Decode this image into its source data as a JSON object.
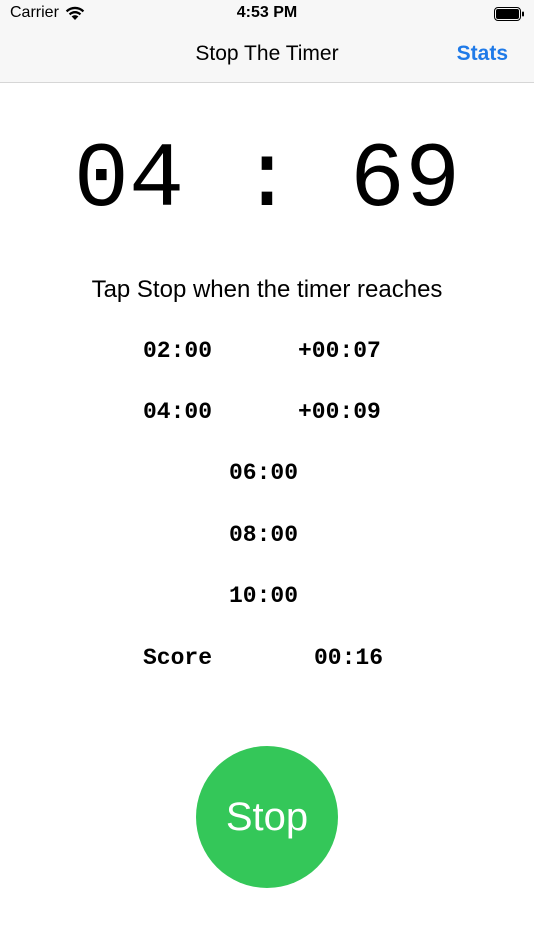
{
  "status_bar": {
    "carrier": "Carrier",
    "time": "4:53 PM",
    "wifi_icon": "wifi-icon",
    "battery_icon": "battery-icon"
  },
  "nav": {
    "title": "Stop The Timer",
    "stats_label": "Stats"
  },
  "timer": {
    "display": "04 : 69"
  },
  "instruction": "Tap Stop when the timer reaches",
  "targets": [
    {
      "target": "02:00",
      "delta": "+00:07"
    },
    {
      "target": "04:00",
      "delta": "+00:09"
    },
    {
      "target": "06:00",
      "delta": ""
    },
    {
      "target": "08:00",
      "delta": ""
    },
    {
      "target": "10:00",
      "delta": ""
    }
  ],
  "score": {
    "label": "Score",
    "value": "00:16"
  },
  "stop_button": {
    "label": "Stop",
    "color": "#34c759"
  },
  "colors": {
    "accent": "#1f7ae8",
    "bar_background": "#f7f7f7"
  }
}
